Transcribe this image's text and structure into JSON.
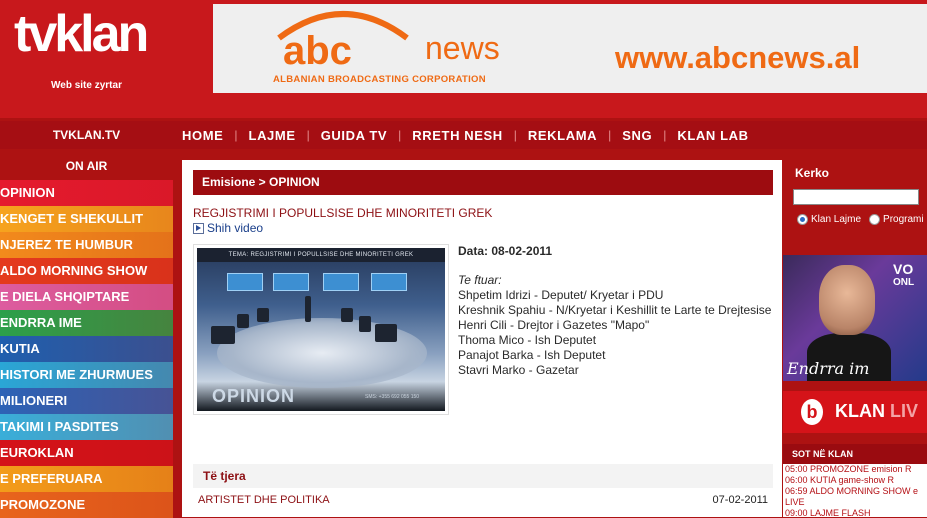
{
  "logo": {
    "text": "tvklan",
    "subtitle": "Web site zyrtar"
  },
  "banner": {
    "abc": "abc",
    "news": "news",
    "corp": "ALBANIAN BROADCASTING CORPORATION",
    "url": "www.abcnews.al",
    "color": "#ef6a14"
  },
  "brand_cell": "TVKLAN.TV",
  "nav": [
    "HOME",
    "LAJME",
    "GUIDA TV",
    "RRETH NESH",
    "REKLAMA",
    "SNG",
    "KLAN LAB"
  ],
  "on_air": "ON AIR",
  "sidebar": [
    {
      "label": "OPINION",
      "color": "#e51a2e"
    },
    {
      "label": "KENGET E SHEKULLIT",
      "color": "#f6a31e"
    },
    {
      "label": "NJEREZ TE HUMBUR",
      "color": "#f28a1c"
    },
    {
      "label": "ALDO MORNING SHOW",
      "color": "#e43a1d"
    },
    {
      "label": "E DIELA SHQIPTARE",
      "color": "#dd5c9f"
    },
    {
      "label": "ENDRRA IME",
      "color": "#2ca04a"
    },
    {
      "label": "KUTIA",
      "color": "#1f5fae"
    },
    {
      "label": "HISTORI ME ZHURMUES",
      "color": "#2aa6d6"
    },
    {
      "label": "MILIONERI",
      "color": "#2d63b6"
    },
    {
      "label": "TAKIMI I PASDITES",
      "color": "#3aaed9"
    },
    {
      "label": "EUROKLAN",
      "color": "#d41219"
    },
    {
      "label": "E PREFERUARA",
      "color": "#f39c1a"
    },
    {
      "label": "PROMOZONE",
      "color": "#e8641c"
    }
  ],
  "main": {
    "breadcrumb": "Emisione > OPINION",
    "title": "REGJISTRIMI I POPULLSISE DHE MINORITETI GREK",
    "video_link": "Shih video",
    "thumb_header": "TEMA: REGJISTRIMI I POPULLSISE DHE MINORITETI GREK",
    "thumb_logo": "OPINION",
    "thumb_sms": "SMS: +355 692 055 150",
    "date": "Data: 08-02-2011",
    "guests_label": "Te ftuar:",
    "guests": [
      "Shpetim Idrizi - Deputet/ Kryetar i PDU",
      "Kreshnik Spahiu - N/Kryetar i Keshillit te Larte te Drejtesise",
      "Henri Cili - Drejtor i Gazetes \"Mapo\"",
      "Thoma Mico - Ish Deputet",
      "Panajot Barka - Ish Deputet",
      "Stavri Marko - Gazetar"
    ],
    "other_header": "Të tjera",
    "other_items": [
      {
        "title": "ARTISTET DHE POLITIKA",
        "date": "07-02-2011"
      }
    ]
  },
  "right": {
    "search_label": "Kerko",
    "search_value": "",
    "radio_1": "Klan Lajme",
    "radio_2": "Programi",
    "promo_vo": "VO",
    "promo_onl": "ONL",
    "promo_caption": "Endrra im",
    "live_text": "KLAN",
    "live_suffix": "LIV",
    "sot_header": "SOT NË KLAN",
    "schedule": [
      "05:00 PROMOZONE emision R",
      "06:00 KUTIA game-show R",
      "06:59 ALDO MORNING SHOW e",
      "LIVE",
      "09:00 LAJME FLASH"
    ]
  }
}
